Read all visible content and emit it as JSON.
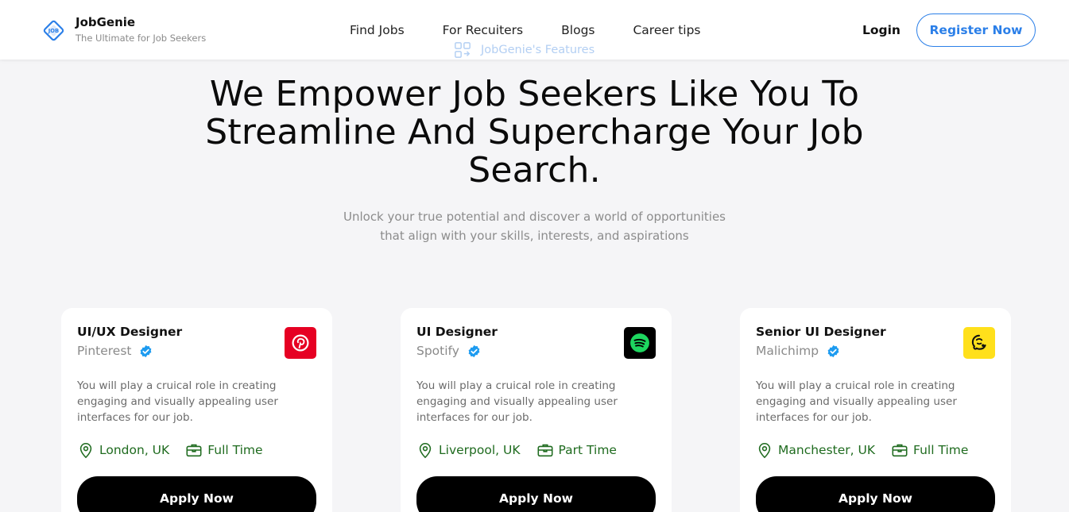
{
  "header": {
    "brand_name": "JobGenie",
    "brand_tagline": "The Ultimate for Job Seekers",
    "nav": [
      "Find Jobs",
      "For Recuiters",
      "Blogs",
      "Career tips"
    ],
    "login": "Login",
    "register": "Register Now"
  },
  "features_tag": "JobGenie's Features",
  "hero": {
    "title_lines": [
      "We Empower Job Seekers Like You To",
      "Streamline And Supercharge Your Job",
      "Search."
    ],
    "subtitle_lines": [
      "Unlock your true potential and discover a world of opportunities",
      "that align with your skills, interests, and aspirations"
    ]
  },
  "colors": {
    "accent": "#2b7fe8",
    "location_text": "#1f6b1f",
    "pinterest": "#e60023",
    "spotify_bg": "#000000",
    "spotify_green": "#1ed760",
    "mailchimp": "#ffe01b"
  },
  "jobs": [
    {
      "title": "UI/UX Designer",
      "company": "Pinterest",
      "logo_icon": "pinterest-logo",
      "description": "You will play a cruical role in creating engaging and visually appealing user interfaces for our job.",
      "location": "London, UK",
      "type": "Full Time",
      "apply": "Apply Now"
    },
    {
      "title": "UI Designer",
      "company": "Spotify",
      "logo_icon": "spotify-logo",
      "description": "You will play a cruical role in creating engaging and visually appealing user interfaces for our job.",
      "location": "Liverpool, UK",
      "type": "Part Time",
      "apply": "Apply Now"
    },
    {
      "title": "Senior UI Designer",
      "company": "Malichimp",
      "logo_icon": "mailchimp-logo",
      "description": "You will play a cruical role in creating engaging and visually appealing user interfaces for our job.",
      "location": "Manchester, UK",
      "type": "Full Time",
      "apply": "Apply Now"
    }
  ]
}
